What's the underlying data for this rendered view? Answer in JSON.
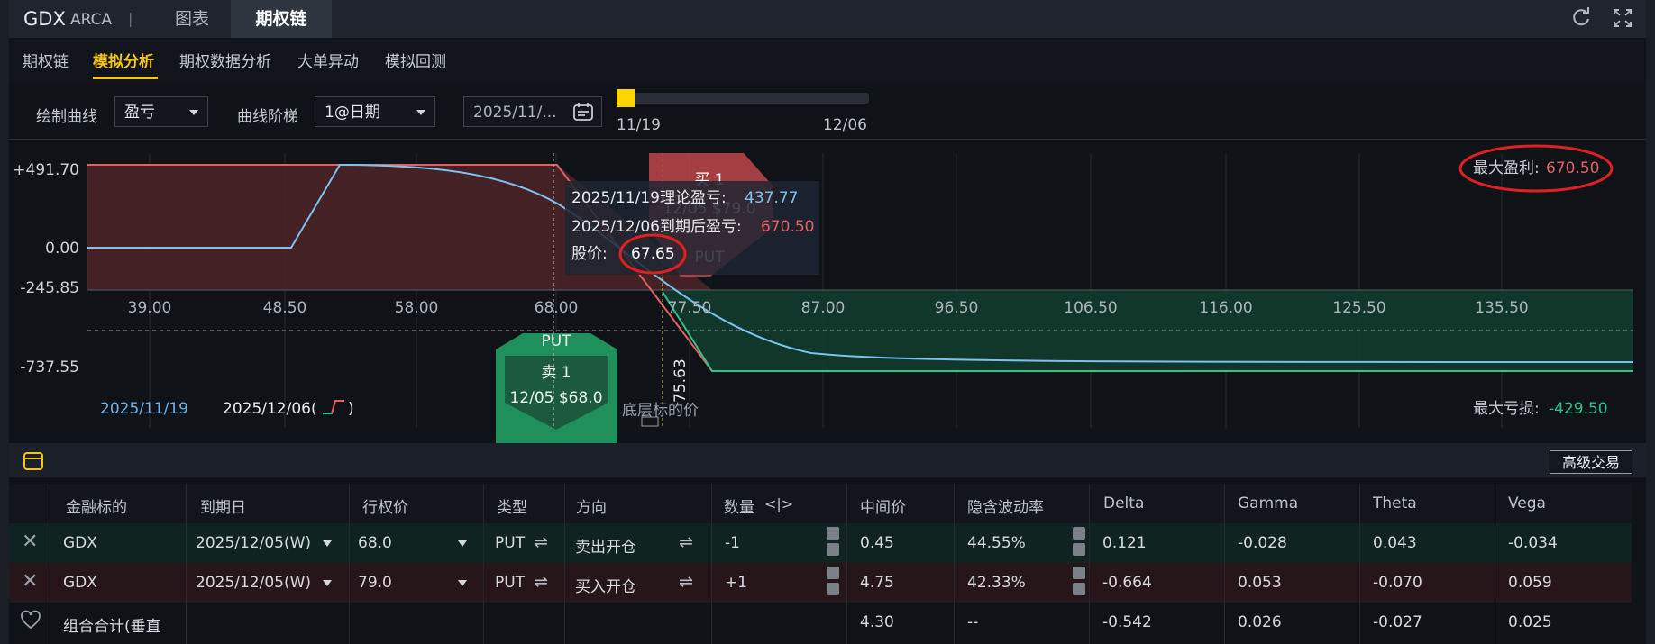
{
  "header": {
    "ticker": "GDX",
    "exchange": "ARCA",
    "separator": "|",
    "tabs": [
      "图表",
      "期权链"
    ],
    "active_tab": "期权链"
  },
  "subnav": {
    "items": [
      "期权链",
      "模拟分析",
      "期权数据分析",
      "大单异动",
      "模拟回测"
    ],
    "active": "模拟分析"
  },
  "controls": {
    "draw_curve_label": "绘制曲线",
    "draw_curve_value": "盈亏",
    "curve_step_label": "曲线阶梯",
    "curve_step_value": "1@日期",
    "date_value": "2025/11/...",
    "slider_start": "11/19",
    "slider_end": "12/06",
    "slider_position": 0.0
  },
  "chart_data": {
    "type": "line",
    "y_ticks": [
      "+491.70",
      "0.00",
      "-245.85",
      "-737.55"
    ],
    "x_ticks": [
      "39.00",
      "48.50",
      "58.00",
      "68.00",
      "77.50",
      "87.00",
      "96.50",
      "106.50",
      "116.00",
      "125.50",
      "135.50"
    ],
    "max_profit_label": "最大盈利:",
    "max_profit_value": "670.50",
    "max_loss_label": "最大亏损:",
    "max_loss_value": "-429.50",
    "series": [
      {
        "name": "2025/11/19",
        "color": "#6fb3e8"
      },
      {
        "name": "2025/12/06(",
        "color": "#e8eaed"
      }
    ],
    "tooltip": {
      "theory_label": "2025/11/19理论盈亏:",
      "theory_value": "437.77",
      "expiry_label": "2025/12/06到期后盈亏:",
      "expiry_value": "670.50",
      "price_label": "股价:",
      "price_value": "67.65"
    },
    "buy_marker": {
      "action": "买 1",
      "detail": "12/05 $79.0",
      "type": "PUT",
      "color": "#c0474a"
    },
    "sell_marker": {
      "type": "PUT",
      "action": "卖 1",
      "detail": "12/05 $68.0",
      "color": "#1f8f5c"
    },
    "breakeven_label": "75.63",
    "underlying_label": "底层标的价",
    "colors": {
      "profit_fill": "#4a2326",
      "loss_fill": "#123a2b",
      "profit_line": "#e35f63",
      "loss_line": "#2fc28a",
      "theory_line": "#7cc2f0",
      "highlight": "#e02020"
    }
  },
  "table": {
    "headers": [
      "金融标的",
      "到期日",
      "行权价",
      "类型",
      "方向",
      "数量",
      "中间价",
      "隐含波动率",
      "Delta",
      "Gamma",
      "Theta",
      "Vega"
    ],
    "rows": [
      {
        "symbol": "GDX",
        "expiry": "2025/12/05(W)",
        "strike": "68.0",
        "type": "PUT",
        "side": "卖出开仓",
        "qty": "-1",
        "mid": "0.45",
        "iv": "44.55%",
        "delta": "0.121",
        "gamma": "-0.028",
        "theta": "0.043",
        "vega": "-0.034"
      },
      {
        "symbol": "GDX",
        "expiry": "2025/12/05(W)",
        "strike": "79.0",
        "type": "PUT",
        "side": "买入开仓",
        "qty": "+1",
        "mid": "4.75",
        "iv": "42.33%",
        "delta": "-0.664",
        "gamma": "0.053",
        "theta": "-0.070",
        "vega": "0.059"
      }
    ],
    "summary": {
      "label": "组合合计(垂直",
      "mid": "4.30",
      "iv": "--",
      "delta": "-0.542",
      "gamma": "0.026",
      "theta": "-0.027",
      "vega": "0.025"
    },
    "advanced_button": "高级交易"
  }
}
